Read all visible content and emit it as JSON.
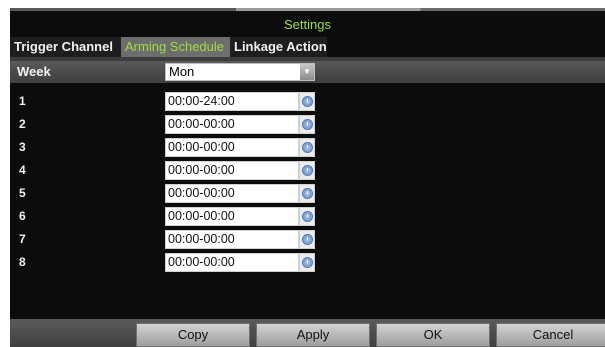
{
  "window": {
    "title": "Settings"
  },
  "tabs": [
    {
      "label": "Trigger Channel",
      "active": false
    },
    {
      "label": "Arming Schedule",
      "active": true
    },
    {
      "label": "Linkage Action",
      "active": false
    }
  ],
  "week": {
    "label": "Week",
    "value": "Mon"
  },
  "schedule": [
    {
      "num": "1",
      "time": "00:00-24:00"
    },
    {
      "num": "2",
      "time": "00:00-00:00"
    },
    {
      "num": "3",
      "time": "00:00-00:00"
    },
    {
      "num": "4",
      "time": "00:00-00:00"
    },
    {
      "num": "5",
      "time": "00:00-00:00"
    },
    {
      "num": "6",
      "time": "00:00-00:00"
    },
    {
      "num": "7",
      "time": "00:00-00:00"
    },
    {
      "num": "8",
      "time": "00:00-00:00"
    }
  ],
  "buttons": {
    "copy": "Copy",
    "apply": "Apply",
    "ok": "OK",
    "cancel": "Cancel"
  },
  "colors": {
    "accent": "#9be03c",
    "background": "#0c0c0c",
    "active_tab": "#6d6d6d"
  },
  "icons": {
    "dropdown": "chevron-down-icon",
    "time_picker": "clock-icon"
  }
}
